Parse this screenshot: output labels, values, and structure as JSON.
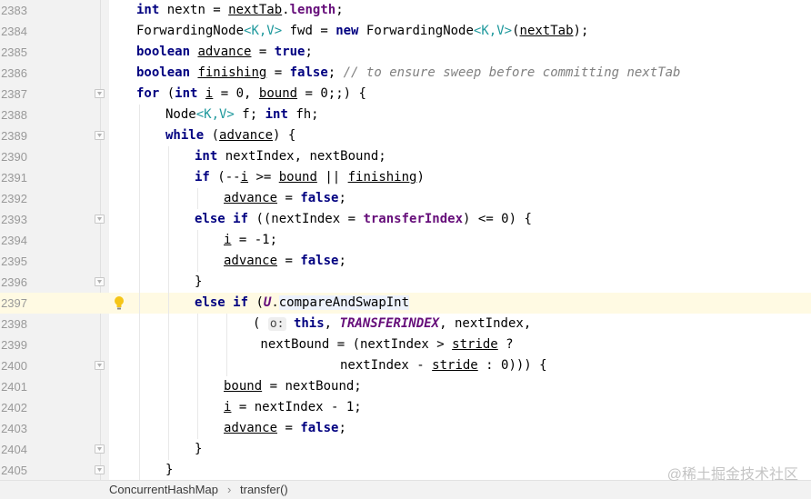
{
  "editor": {
    "lines": [
      {
        "num": "2383",
        "indent": 1,
        "fold": false,
        "tokens": [
          {
            "t": "int",
            "c": "kw"
          },
          {
            "t": " nextn = "
          },
          {
            "t": "nextTab",
            "c": "ul"
          },
          {
            "t": "."
          },
          {
            "t": "length",
            "c": "fld"
          },
          {
            "t": ";"
          }
        ]
      },
      {
        "num": "2384",
        "indent": 1,
        "fold": false,
        "tokens": [
          {
            "t": "ForwardingNode"
          },
          {
            "t": "<K,V>",
            "c": "gp"
          },
          {
            "t": " fwd = "
          },
          {
            "t": "new",
            "c": "kw"
          },
          {
            "t": " ForwardingNode"
          },
          {
            "t": "<K,V>",
            "c": "gp"
          },
          {
            "t": "("
          },
          {
            "t": "nextTab",
            "c": "ul"
          },
          {
            "t": ");"
          }
        ]
      },
      {
        "num": "2385",
        "indent": 1,
        "fold": false,
        "tokens": [
          {
            "t": "boolean",
            "c": "kw"
          },
          {
            "t": " "
          },
          {
            "t": "advance",
            "c": "ul"
          },
          {
            "t": " = "
          },
          {
            "t": "true",
            "c": "kw"
          },
          {
            "t": ";"
          }
        ]
      },
      {
        "num": "2386",
        "indent": 1,
        "fold": false,
        "tokens": [
          {
            "t": "boolean",
            "c": "kw"
          },
          {
            "t": " "
          },
          {
            "t": "finishing",
            "c": "ul"
          },
          {
            "t": " = "
          },
          {
            "t": "false",
            "c": "kw"
          },
          {
            "t": "; "
          },
          {
            "t": "// to ensure sweep before committing nextTab",
            "c": "cmt"
          }
        ]
      },
      {
        "num": "2387",
        "indent": 1,
        "fold": true,
        "tokens": [
          {
            "t": "for",
            "c": "kw"
          },
          {
            "t": " ("
          },
          {
            "t": "int",
            "c": "kw"
          },
          {
            "t": " "
          },
          {
            "t": "i",
            "c": "ul"
          },
          {
            "t": " = 0, "
          },
          {
            "t": "bound",
            "c": "ul"
          },
          {
            "t": " = 0;;) {"
          }
        ]
      },
      {
        "num": "2388",
        "indent": 2,
        "fold": false,
        "tokens": [
          {
            "t": "Node"
          },
          {
            "t": "<K,V>",
            "c": "gp"
          },
          {
            "t": " f; "
          },
          {
            "t": "int",
            "c": "kw"
          },
          {
            "t": " fh;"
          }
        ]
      },
      {
        "num": "2389",
        "indent": 2,
        "fold": true,
        "tokens": [
          {
            "t": "while",
            "c": "kw"
          },
          {
            "t": " ("
          },
          {
            "t": "advance",
            "c": "ul"
          },
          {
            "t": ") {"
          }
        ]
      },
      {
        "num": "2390",
        "indent": 3,
        "fold": false,
        "tokens": [
          {
            "t": "int",
            "c": "kw"
          },
          {
            "t": " nextIndex, nextBound;"
          }
        ]
      },
      {
        "num": "2391",
        "indent": 3,
        "fold": false,
        "tokens": [
          {
            "t": "if",
            "c": "kw"
          },
          {
            "t": " (--"
          },
          {
            "t": "i",
            "c": "ul"
          },
          {
            "t": " >= "
          },
          {
            "t": "bound",
            "c": "ul"
          },
          {
            "t": " || "
          },
          {
            "t": "finishing",
            "c": "ul"
          },
          {
            "t": ")"
          }
        ]
      },
      {
        "num": "2392",
        "indent": 4,
        "fold": false,
        "tokens": [
          {
            "t": "advance",
            "c": "ul"
          },
          {
            "t": " = "
          },
          {
            "t": "false",
            "c": "kw"
          },
          {
            "t": ";"
          }
        ]
      },
      {
        "num": "2393",
        "indent": 3,
        "fold": true,
        "tokens": [
          {
            "t": "else",
            "c": "kw"
          },
          {
            "t": " "
          },
          {
            "t": "if",
            "c": "kw"
          },
          {
            "t": " ((nextIndex = "
          },
          {
            "t": "transferIndex",
            "c": "fld"
          },
          {
            "t": ") <= 0) {"
          }
        ]
      },
      {
        "num": "2394",
        "indent": 4,
        "fold": false,
        "tokens": [
          {
            "t": "i",
            "c": "ul"
          },
          {
            "t": " = -1;"
          }
        ]
      },
      {
        "num": "2395",
        "indent": 4,
        "fold": false,
        "tokens": [
          {
            "t": "advance",
            "c": "ul"
          },
          {
            "t": " = "
          },
          {
            "t": "false",
            "c": "kw"
          },
          {
            "t": ";"
          }
        ]
      },
      {
        "num": "2396",
        "indent": 3,
        "fold": true,
        "tokens": [
          {
            "t": "}"
          }
        ]
      },
      {
        "num": "2397",
        "indent": 3,
        "fold": false,
        "current": true,
        "bulb": true,
        "tokens": [
          {
            "t": "else",
            "c": "kw"
          },
          {
            "t": " "
          },
          {
            "t": "if",
            "c": "kw"
          },
          {
            "t": " ("
          },
          {
            "t": "U",
            "c": "cls"
          },
          {
            "t": "."
          },
          {
            "t": "compareAndSwapInt",
            "c": "hl"
          }
        ]
      },
      {
        "num": "2398",
        "indent": 5,
        "fold": false,
        "tokens": [
          {
            "t": "( "
          },
          {
            "t": "o:",
            "c": "hint"
          },
          {
            "t": " "
          },
          {
            "t": "this",
            "c": "kw"
          },
          {
            "t": ", "
          },
          {
            "t": "TRANSFERINDEX",
            "c": "sfld"
          },
          {
            "t": ", nextIndex,"
          }
        ]
      },
      {
        "num": "2399",
        "indent": 5,
        "fold": false,
        "tokens": [
          {
            "t": " nextBound = (nextIndex > "
          },
          {
            "t": "stride",
            "c": "ul"
          },
          {
            "t": " ?"
          }
        ]
      },
      {
        "num": "2400",
        "indent": 8,
        "fold": true,
        "tokens": [
          {
            "t": "nextIndex - "
          },
          {
            "t": "stride",
            "c": "ul"
          },
          {
            "t": " : 0))) {"
          }
        ]
      },
      {
        "num": "2401",
        "indent": 4,
        "fold": false,
        "tokens": [
          {
            "t": "bound",
            "c": "ul"
          },
          {
            "t": " = nextBound;"
          }
        ]
      },
      {
        "num": "2402",
        "indent": 4,
        "fold": false,
        "tokens": [
          {
            "t": "i",
            "c": "ul"
          },
          {
            "t": " = nextIndex - 1;"
          }
        ]
      },
      {
        "num": "2403",
        "indent": 4,
        "fold": false,
        "tokens": [
          {
            "t": "advance",
            "c": "ul"
          },
          {
            "t": " = "
          },
          {
            "t": "false",
            "c": "kw"
          },
          {
            "t": ";"
          }
        ]
      },
      {
        "num": "2404",
        "indent": 3,
        "fold": true,
        "tokens": [
          {
            "t": "}"
          }
        ]
      },
      {
        "num": "2405",
        "indent": 2,
        "fold": true,
        "tokens": [
          {
            "t": "}"
          }
        ]
      }
    ]
  },
  "breadcrumb": {
    "class_name": "ConcurrentHashMap",
    "separator": "›",
    "method": "transfer()"
  },
  "watermark": "@稀土掘金技术社区",
  "icons": {
    "fold_marker": "fold-icon",
    "intention_bulb": "lightbulb-icon"
  }
}
